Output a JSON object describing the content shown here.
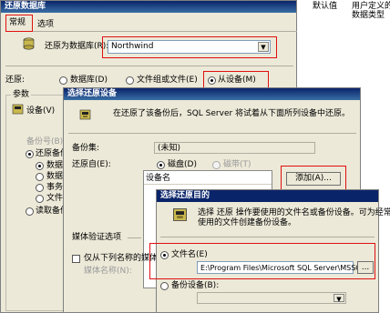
{
  "bg_columns": {
    "col1": "默认值",
    "col2_line1": "用户定义的",
    "col2_line2": "数据类型"
  },
  "dlg1": {
    "title": "还原数据库",
    "tabs": [
      "常规",
      "选项"
    ],
    "restore_as_label": "还原为数据库(R):",
    "restore_as_value": "Northwind",
    "restore_label": "还原:",
    "restore_opts": [
      "数据库(D)",
      "文件组或文件(E)",
      "从设备(M)"
    ],
    "params_group": "参数",
    "device_label": "设备(V)",
    "backup_no_label": "备份号(B)",
    "restore_backup_radio": "还原备份(",
    "sub_opts": [
      "数据库",
      "数据库",
      "事务日",
      "文件或"
    ],
    "read_backup_radio": "读取备份("
  },
  "dlg2": {
    "title": "选择还原设备",
    "desc": "在还原了该备份后，SQL Server 将试着从下面所列设备中还原。",
    "backup_set_label": "备份集:",
    "backup_set_value": "(未知)",
    "restore_from_label": "还原自(E):",
    "disk_radio": "磁盘(D)",
    "tape_radio": "磁带(T)",
    "device_name_header": "设备名",
    "add_button": "添加(A)...",
    "media_verify_label": "媒体验证选项",
    "check_media_label": "仅从下列名称的媒体中还",
    "media_name_label": "媒体名称(N):"
  },
  "dlg3": {
    "title": "选择还原目的",
    "desc_line1": "选择 还原 操作要使用的文件名或备份设备。可为经常",
    "desc_line2": "使用的文件创建备份设备。",
    "filename_radio": "文件名(E)",
    "filename_value": "E:\\Program Files\\Microsoft SQL Server\\MSSQL\\",
    "browse_button": "...",
    "backup_device_radio": "备份设备(B):"
  },
  "colors": {
    "highlight": "#e01010",
    "dialog_bg": "#ece9d8",
    "title_blue": "#0a246a"
  }
}
